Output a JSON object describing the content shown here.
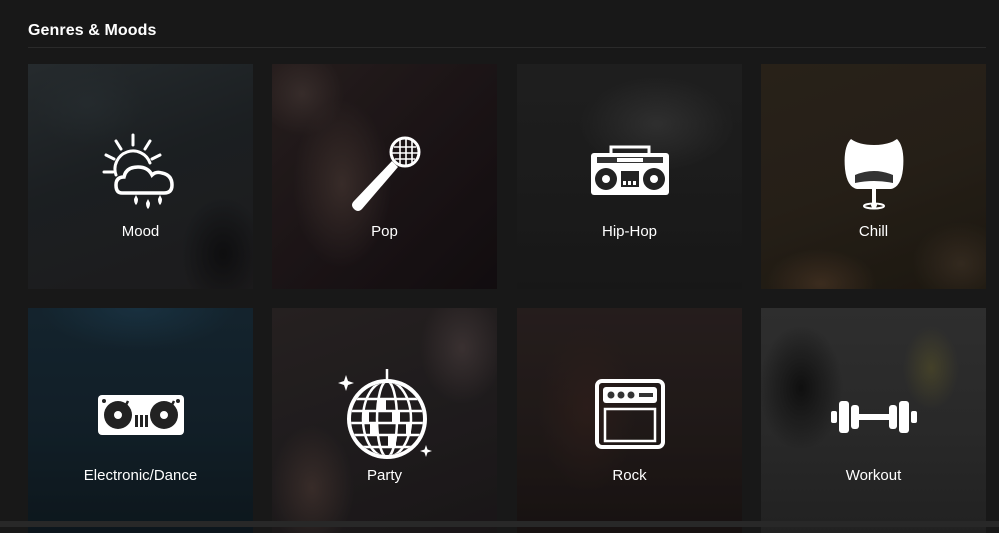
{
  "section": {
    "title": "Genres & Moods"
  },
  "tiles": [
    {
      "label": "Mood",
      "icon": "weather-sun-cloud-rain-icon"
    },
    {
      "label": "Pop",
      "icon": "microphone-icon"
    },
    {
      "label": "Hip-Hop",
      "icon": "boombox-icon"
    },
    {
      "label": "Chill",
      "icon": "egg-chair-icon"
    },
    {
      "label": "Electronic/Dance",
      "icon": "dj-turntables-icon"
    },
    {
      "label": "Party",
      "icon": "disco-ball-icon"
    },
    {
      "label": "Rock",
      "icon": "amplifier-icon"
    },
    {
      "label": "Workout",
      "icon": "dumbbell-icon"
    }
  ],
  "colors": {
    "background": "#181818",
    "text": "#ffffff"
  }
}
